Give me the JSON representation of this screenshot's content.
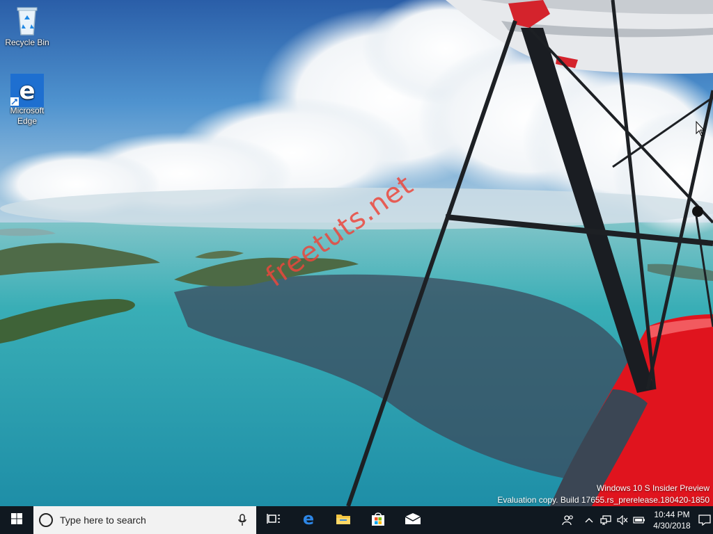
{
  "desktop": {
    "icons": [
      {
        "label": "Recycle Bin",
        "icon": "recycle-bin-icon"
      },
      {
        "label": "Microsoft Edge",
        "label_line1": "Microsoft",
        "label_line2": "Edge",
        "icon": "edge-icon"
      }
    ],
    "watermark": {
      "line1": "Windows 10 S Insider Preview",
      "line2": "Evaluation copy. Build 17655.rs_prerelease.180420-1850"
    },
    "overlay_text": "freetuts.net"
  },
  "taskbar": {
    "start_icon": "windows-start-icon",
    "search": {
      "placeholder": "Type here to search",
      "icon": "cortana-circle-icon",
      "mic_icon": "microphone-icon"
    },
    "pinned": [
      {
        "name": "task-view",
        "icon": "task-view-icon"
      },
      {
        "name": "edge",
        "icon": "edge-icon"
      },
      {
        "name": "file-explorer",
        "icon": "folder-icon"
      },
      {
        "name": "store",
        "icon": "store-bag-icon"
      },
      {
        "name": "mail",
        "icon": "mail-icon"
      }
    ],
    "tray": {
      "icons": [
        "people-icon",
        "chevron-up-icon",
        "network-icon",
        "volume-muted-icon",
        "battery-icon"
      ],
      "time": "10:44 PM",
      "date": "4/30/2018",
      "notification_icon": "action-center-icon"
    }
  },
  "colors": {
    "taskbar_bg": "#101820",
    "edge_blue": "#1e6fd0",
    "plane_red": "#e0141e",
    "sea": "#2aa3b0"
  }
}
